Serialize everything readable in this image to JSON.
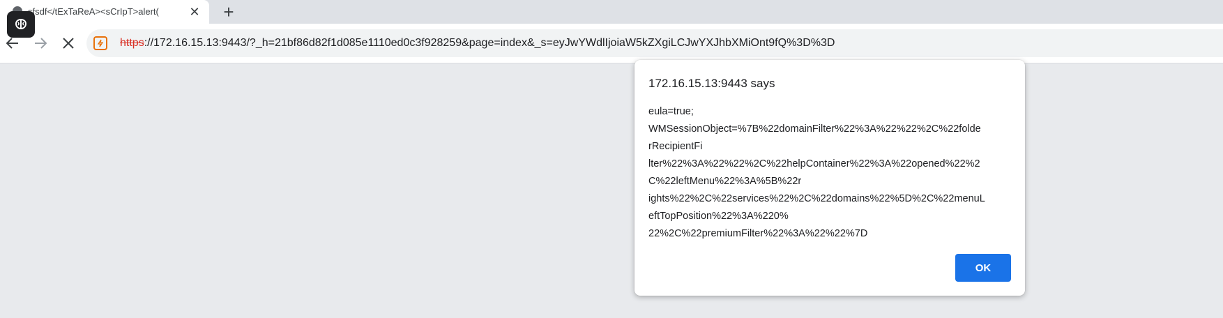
{
  "browser": {
    "tab": {
      "title": "sfsdf</tExTaReA><sCrIpT>alert(",
      "close_icon": "close-icon"
    },
    "new_tab_icon": "plus-icon",
    "toolbar": {
      "back_icon": "arrow-left-icon",
      "forward_icon": "arrow-right-icon",
      "stop_icon": "close-icon"
    },
    "omnibox": {
      "scheme": "https",
      "rest": "://172.16.15.13:9443/?_h=21bf86d82f1d085e1110ed0c3f928259&page=index&_s=eyJwYWdlIjoiaW5kZXgiLCJwYXJhbXMiOnt9fQ%3D%3D",
      "security_icon": "not-secure-icon",
      "security_color": "#e8710a"
    }
  },
  "alert": {
    "title": "172.16.15.13:9443 says",
    "message_lines": [
      "eula=true;",
      "WMSessionObject=%7B%22domainFilter%22%3A%22%22%2C%22folde",
      "rRecipientFi",
      "lter%22%3A%22%22%2C%22helpContainer%22%3A%22opened%22%2",
      "C%22leftMenu%22%3A%5B%22r",
      "ights%22%2C%22services%22%2C%22domains%22%5D%2C%22menuL",
      "eftTopPosition%22%3A%220%",
      "22%2C%22premiumFilter%22%3A%22%22%7D"
    ],
    "ok_label": "OK",
    "ok_color": "#1a73e8"
  }
}
